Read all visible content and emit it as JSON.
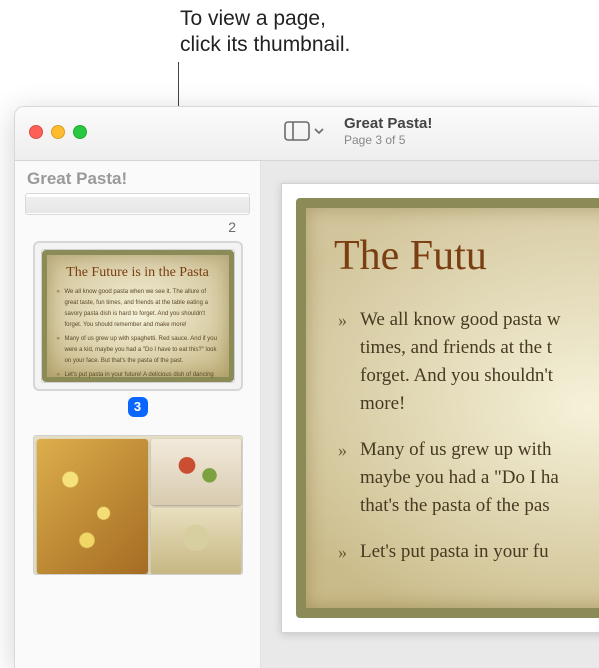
{
  "callout": {
    "line1": "To view a page,",
    "line2": "click its thumbnail."
  },
  "toolbar": {
    "doc_title": "Great Pasta!",
    "page_indicator": "Page 3 of 5"
  },
  "sidebar": {
    "heading": "Great Pasta!",
    "thumb2_label": "2",
    "thumb3_badge": "3",
    "thumb3": {
      "title": "The Future is in the Pasta",
      "b1": "We all know good pasta when we see it. The allure of great taste, fun times, and friends at the table eating a savory pasta dish is hard to forget. And you shouldn't forget. You should remember and make more!",
      "b2": "Many of us grew up with spaghetti. Red sauce. And if you were a kid, maybe you had a \"Do I have to eat this?\" look on your face. But that's the pasta of the past.",
      "b3": "Let's put pasta in your future! A delicious dish of dancing noodles!"
    }
  },
  "page": {
    "title": "The Futu",
    "b1a": "We all know good pasta w",
    "b1b": "times, and friends at the t",
    "b1c": "forget. And you shouldn't",
    "b1d": "more!",
    "b2a": "Many of us grew up with",
    "b2b": "maybe you had a \"Do I ha",
    "b2c": "that's the pasta of the pas",
    "b3a": "Let's put pasta in your fu"
  }
}
